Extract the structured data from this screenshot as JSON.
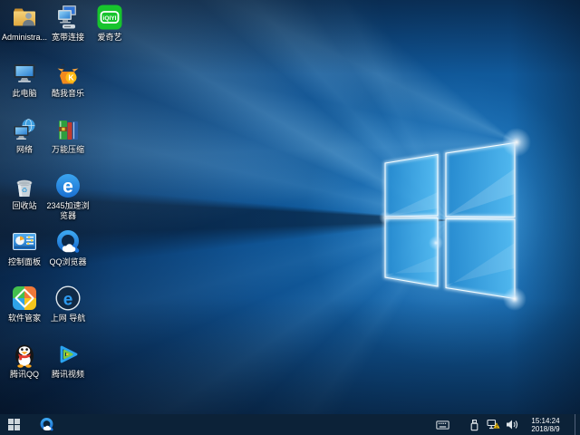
{
  "wallpaper": {
    "name": "windows-10-hero",
    "base_color": "#0f5190",
    "accent_color": "#2f9ff0"
  },
  "desktop": {
    "icons": [
      {
        "label": "Administra...",
        "icon": "user-files-folder"
      },
      {
        "label": "宽带连接",
        "icon": "broadband-connection"
      },
      {
        "label": "爱奇艺",
        "icon": "iqiyi"
      },
      {
        "label": "此电脑",
        "icon": "this-pc"
      },
      {
        "label": "酷我音乐",
        "icon": "kuwo-music"
      },
      {
        "label": "网络",
        "icon": "network"
      },
      {
        "label": "万能压缩",
        "icon": "compression-tool"
      },
      {
        "label": "回收站",
        "icon": "recycle-bin"
      },
      {
        "label": "2345加速浏览器",
        "icon": "2345-browser"
      },
      {
        "label": "控制面板",
        "icon": "control-panel"
      },
      {
        "label": "QQ浏览器",
        "icon": "qq-browser"
      },
      {
        "label": "软件管家",
        "icon": "software-manager"
      },
      {
        "label": "上网 导航",
        "icon": "web-navigation"
      },
      {
        "label": "腾讯QQ",
        "icon": "tencent-qq"
      },
      {
        "label": "腾讯视频",
        "icon": "tencent-video"
      }
    ]
  },
  "taskbar": {
    "start": {
      "icon": "windows-logo"
    },
    "pinned": [
      {
        "icon": "qq-browser",
        "label": "QQ浏览器"
      }
    ],
    "tray": {
      "icons": [
        {
          "icon": "touch-keyboard"
        },
        {
          "icon": "usb-device"
        },
        {
          "icon": "network-warning"
        },
        {
          "icon": "volume"
        }
      ]
    },
    "clock": {
      "time": "15:14:24",
      "date": "2018/8/9"
    }
  }
}
